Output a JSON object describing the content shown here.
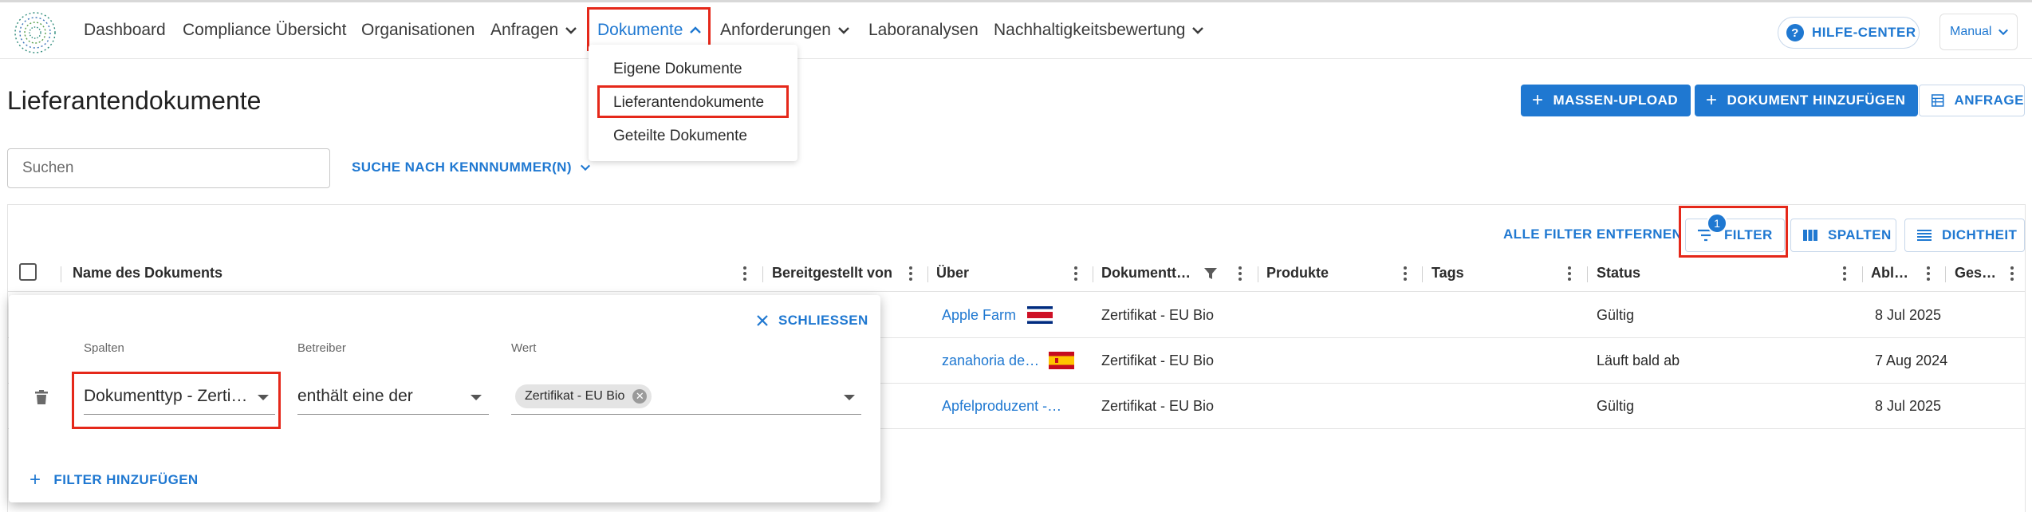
{
  "nav": {
    "items": [
      "Dashboard",
      "Compliance Übersicht",
      "Organisationen",
      "Anfragen",
      "Dokumente",
      "Anforderungen",
      "Laboranalysen",
      "Nachhaltigkeitsbewertung"
    ],
    "help_label": "HILFE-CENTER",
    "manual_label": "Manual"
  },
  "menu": {
    "items": [
      "Eigene Dokumente",
      "Lieferantendokumente",
      "Geteilte Dokumente"
    ]
  },
  "page": {
    "title": "Lieferantendokumente",
    "bulk_upload_label": "MASSEN-UPLOAD",
    "add_document_label": "DOKUMENT HINZUFÜGEN",
    "request_label": "ANFRAGE"
  },
  "search": {
    "placeholder": "Suchen",
    "id_search_label": "SUCHE NACH KENNNUMMER(N)"
  },
  "toolbar": {
    "clear_filters_label": "ALLE FILTER ENTFERNEN",
    "filter_label": "FILTER",
    "filter_count": "1",
    "columns_label": "SPALTEN",
    "density_label": "DICHTHEIT"
  },
  "table": {
    "columns": [
      "Name des Dokuments",
      "Bereitgestellt von",
      "Über",
      "Dokumentt…",
      "Produkte",
      "Tags",
      "Status",
      "Abl…",
      "Ges…"
    ],
    "rows": [
      {
        "ueber": "Apple Farm",
        "doktyp": "Zertifikat - EU Bio",
        "status": "Gültig",
        "ablauf": "8 Jul 2025"
      },
      {
        "ueber": "zanahoria de…",
        "doktyp": "Zertifikat - EU Bio",
        "status": "Läuft bald ab",
        "ablauf": "7 Aug 2024"
      },
      {
        "ueber": "Apfelproduzent -…",
        "doktyp": "Zertifikat - EU Bio",
        "status": "Gültig",
        "ablauf": "8 Jul 2025"
      }
    ]
  },
  "filter_panel": {
    "close_label": "SCHLIESSEN",
    "col_label": "Spalten",
    "op_label": "Betreiber",
    "value_label": "Wert",
    "col_value": "Dokumenttyp - Zerti…",
    "op_value": "enthält eine der",
    "chip_value": "Zertifikat - EU Bio",
    "add_label": "FILTER HINZUFÜGEN"
  },
  "colors": {
    "accent": "#1f78d1",
    "highlight": "#e5281a"
  }
}
